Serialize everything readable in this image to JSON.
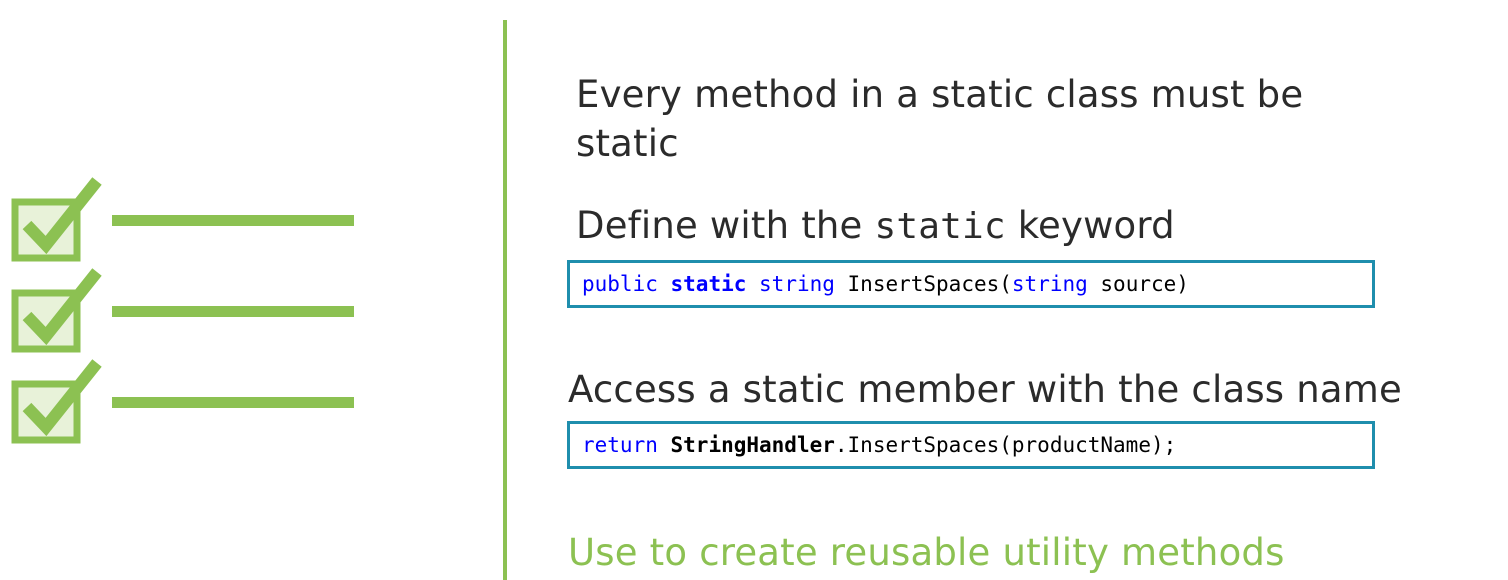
{
  "checklist": {
    "items": 3,
    "colors": {
      "accent": "#8cc152",
      "box_fill": "#e8f2d9"
    }
  },
  "slide": {
    "point1": "Every method in a static class must be static",
    "point2": {
      "prefix": "Define with the",
      "code": "static",
      "suffix": "keyword"
    },
    "code1": {
      "kw_public": "public",
      "kw_static": "static",
      "kw_string": "string",
      "method": " InsertSpaces(",
      "kw_string2": "string",
      "rest": " source)"
    },
    "point3": "Access a static member with the class name",
    "code2": {
      "kw_return": "return",
      "class_name": "StringHandler",
      "rest": ".InsertSpaces(productName);"
    },
    "point4": "Use to create reusable utility methods"
  },
  "colors": {
    "text": "#2b2b2b",
    "accent_green": "#8cc152",
    "code_border": "#1f8ead",
    "keyword_blue": "#0000ff"
  }
}
